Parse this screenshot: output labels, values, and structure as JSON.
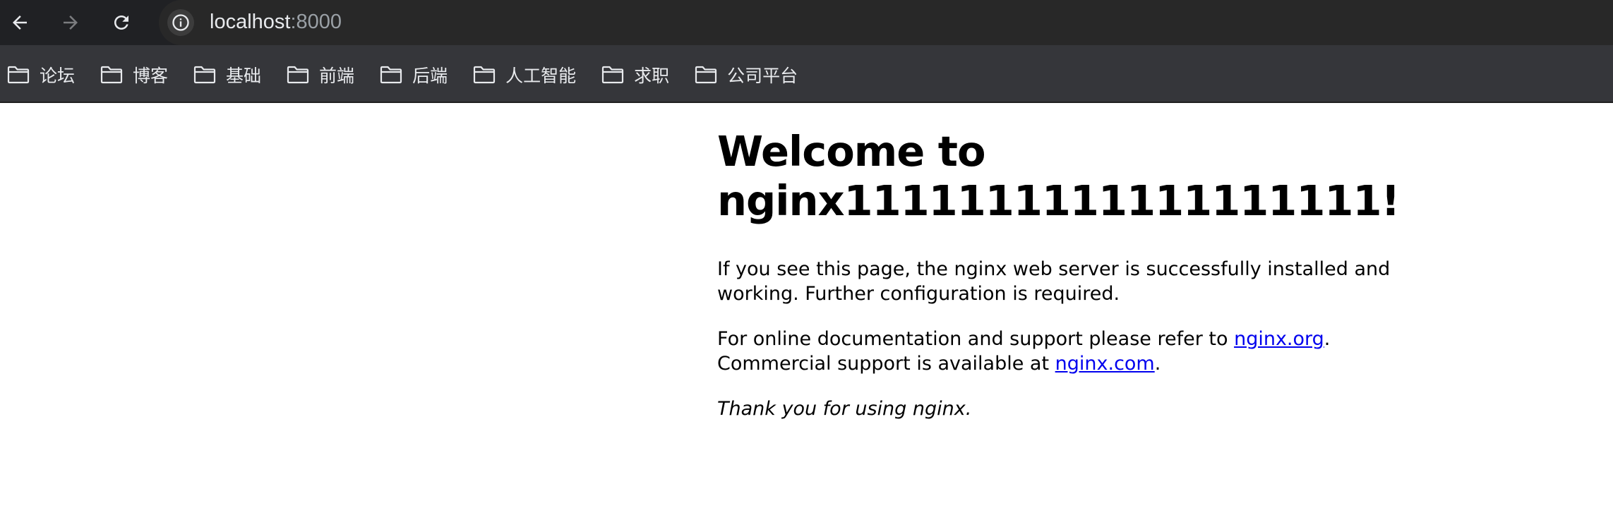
{
  "browser": {
    "url_host": "localhost",
    "url_port": ":8000"
  },
  "bookmarks": [
    {
      "label": "论坛"
    },
    {
      "label": "博客"
    },
    {
      "label": "基础"
    },
    {
      "label": "前端"
    },
    {
      "label": "后端"
    },
    {
      "label": "人工智能"
    },
    {
      "label": "求职"
    },
    {
      "label": "公司平台"
    }
  ],
  "page": {
    "heading_line1": "Welcome to",
    "heading_line2": "nginx1111111111111111111!",
    "para1": "If you see this page, the nginx web server is successfully installed and working. Further configuration is required.",
    "para2_prefix": "For online documentation and support please refer to ",
    "link_org": "nginx.org",
    "para2_mid": ".",
    "para2_line2": "Commercial support is available at ",
    "link_com": "nginx.com",
    "para2_end": ".",
    "thanks": "Thank you for using nginx."
  }
}
